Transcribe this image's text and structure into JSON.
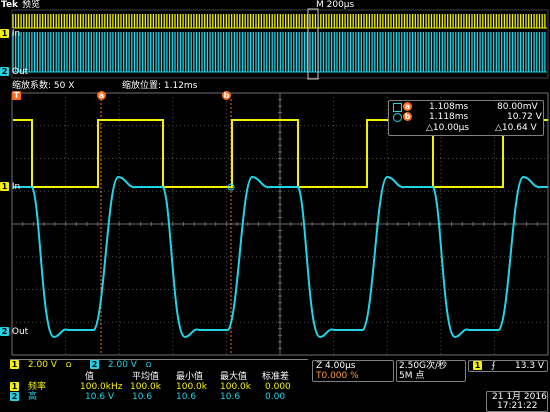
{
  "header": {
    "brand": "Tek",
    "mode": "预览",
    "timebase_marker": "M 200µs"
  },
  "overview": {
    "ch1_label": "In",
    "ch2_label": "Out",
    "ch1_number": "1",
    "ch2_number": "2"
  },
  "zoom_bar": {
    "factor_label": "缩放系数: 50 X",
    "position_label": "缩放位置: 1.12ms"
  },
  "markers": {
    "trigger": "T",
    "cursor_a": "a",
    "cursor_b": "b"
  },
  "main": {
    "ch1_label": "In",
    "ch2_label": "Out",
    "ch1_number": "1",
    "ch2_number": "2"
  },
  "cursor_readout": {
    "a_time": "1.108ms",
    "a_value": "80.00mV",
    "b_time": "1.118ms",
    "b_value": "10.72 V",
    "delta_time": "△10.00µs",
    "delta_value": "△10.64 V",
    "a_label": "a",
    "b_label": "b"
  },
  "status": {
    "ch1_scale": "2.00 V",
    "ch2_scale": "2.00 V",
    "ch1_coupling": "Ω",
    "ch2_coupling": "Ω",
    "ch1_number": "1",
    "ch2_number": "2",
    "time_scale": "Z 4.00µs",
    "trigger_pos": "T0.000 %",
    "sample_rate": "2.50G次/秒",
    "record_length": "5M 点",
    "trig_source": "1",
    "trig_slope": "⨍",
    "trig_level": "13.3 V"
  },
  "measurements": {
    "headers": [
      "值",
      "平均值",
      "最小值",
      "最大值",
      "标准差"
    ],
    "rows": [
      {
        "channel": "1",
        "name": "频率",
        "values": [
          "100.0kHz",
          "100.0k",
          "100.0k",
          "100.0k",
          "0.000"
        ]
      },
      {
        "channel": "2",
        "name": "高",
        "values": [
          "10.6 V",
          "10.6",
          "10.6",
          "10.6",
          "0.00"
        ]
      }
    ]
  },
  "clock": {
    "date": "21 1月 2016",
    "time": "17:21:22"
  },
  "colors": {
    "ch1": "#f3f300",
    "ch2": "#21d4e6",
    "cursor": "#ff6a1a",
    "grid": "#505050",
    "frame": "#808080"
  }
}
